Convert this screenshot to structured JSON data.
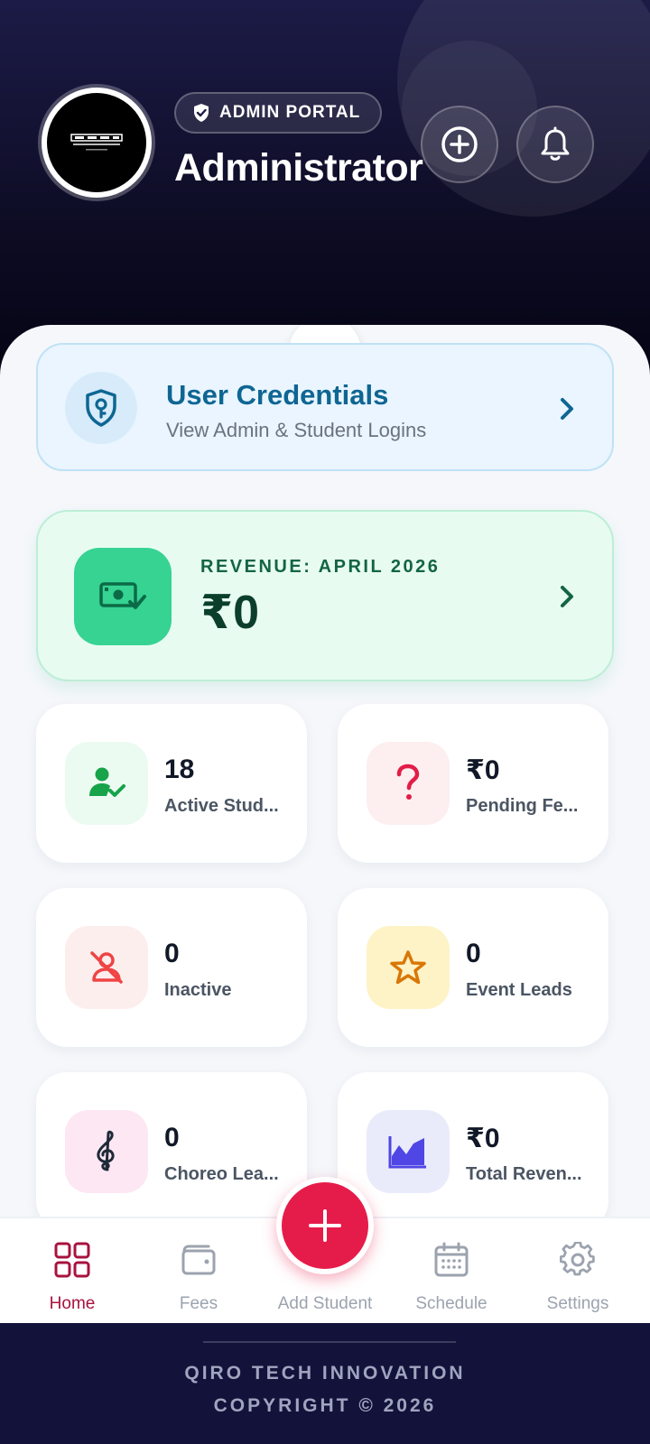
{
  "header": {
    "badge": "ADMIN PORTAL",
    "title": "Administrator",
    "add_icon": "plus-circle-icon",
    "bell_icon": "bell-icon"
  },
  "credentials_card": {
    "title": "User Credentials",
    "subtitle": "View Admin & Student Logins",
    "icon": "shield-key-icon",
    "color": "#0e6693"
  },
  "revenue_card": {
    "label": "REVENUE: APRIL 2026",
    "value": "₹0",
    "icon": "money-check-icon",
    "color": "#36d393"
  },
  "stats": [
    {
      "value": "18",
      "label": "Active Stud...",
      "icon": "user-check-icon",
      "color": "#16a34a"
    },
    {
      "value": "₹0",
      "label": "Pending Fe...",
      "icon": "question-icon",
      "color": "#e11d48"
    },
    {
      "value": "0",
      "label": "Inactive",
      "icon": "user-off-icon",
      "color": "#ef4444"
    },
    {
      "value": "0",
      "label": "Event Leads",
      "icon": "star-icon",
      "color": "#d97706"
    },
    {
      "value": "0",
      "label": "Choreo Lea...",
      "icon": "treble-clef-icon",
      "color": "#1f2937"
    },
    {
      "value": "₹0",
      "label": "Total Reven...",
      "icon": "area-chart-icon",
      "color": "#4f46e5"
    }
  ],
  "nav": {
    "items": [
      {
        "label": "Home",
        "icon": "grid-icon",
        "active": true
      },
      {
        "label": "Fees",
        "icon": "wallet-icon",
        "active": false
      },
      {
        "label": "Add Student",
        "icon": "plus-icon",
        "active": false
      },
      {
        "label": "Schedule",
        "icon": "calendar-icon",
        "active": false
      },
      {
        "label": "Settings",
        "icon": "gear-icon",
        "active": false
      }
    ],
    "active_color": "#a8123f"
  },
  "footer": {
    "line1": "QIRO TECH INNOVATION",
    "line2": "COPYRIGHT © 2026"
  }
}
